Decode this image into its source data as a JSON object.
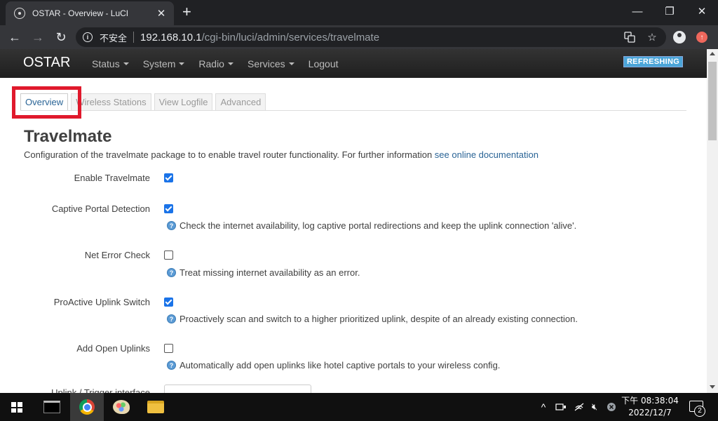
{
  "browser": {
    "tab_title": "OSTAR - Overview - LuCI",
    "tab_close": "✕",
    "new_tab": "+",
    "security_label": "不安全",
    "url_host": "192.168.10.1",
    "url_path": "/cgi-bin/luci/admin/services/travelmate",
    "window_controls": {
      "minimize": "—",
      "maximize": "❐",
      "close": "✕"
    },
    "nav": {
      "back": "←",
      "forward": "→",
      "reload": "↻"
    }
  },
  "luci": {
    "brand": "OSTAR",
    "menu": [
      {
        "label": "Status",
        "has_dropdown": true
      },
      {
        "label": "System",
        "has_dropdown": true
      },
      {
        "label": "Radio",
        "has_dropdown": true
      },
      {
        "label": "Services",
        "has_dropdown": true
      },
      {
        "label": "Logout",
        "has_dropdown": false
      }
    ],
    "refresh_badge": "REFRESHING"
  },
  "page": {
    "tabs": [
      {
        "label": "Overview",
        "active": true
      },
      {
        "label": "Wireless Stations",
        "active": false
      },
      {
        "label": "View Logfile",
        "active": false
      },
      {
        "label": "Advanced",
        "active": false
      }
    ],
    "title": "Travelmate",
    "description": "Configuration of the travelmate package to to enable travel router functionality. For further information ",
    "doc_link": "see online documentation",
    "options": [
      {
        "label": "Enable Travelmate",
        "checked": true,
        "help": ""
      },
      {
        "label": "Captive Portal Detection",
        "checked": true,
        "help": "Check the internet availability, log captive portal redirections and keep the uplink connection 'alive'."
      },
      {
        "label": "Net Error Check",
        "checked": false,
        "help": "Treat missing internet availability as an error."
      },
      {
        "label": "ProActive Uplink Switch",
        "checked": true,
        "help": "Proactively scan and switch to a higher prioritized uplink, despite of an already existing connection."
      },
      {
        "label": "Add Open Uplinks",
        "checked": false,
        "help": "Automatically add open uplinks like hotel captive portals to your wireless config."
      }
    ],
    "partial_label": "Uplink / Trigger interface"
  },
  "taskbar": {
    "clock_time": "下午 08:38:04",
    "clock_date": "2022/12/7",
    "notification_count": "2",
    "tray": {
      "chevron": "^",
      "volume": "🔇︎"
    }
  },
  "colors": {
    "luci_header": "#222222",
    "badge": "#4ba5d8",
    "highlight": "#e0192c",
    "link": "#2a6496",
    "checkbox": "#1a73e8"
  }
}
